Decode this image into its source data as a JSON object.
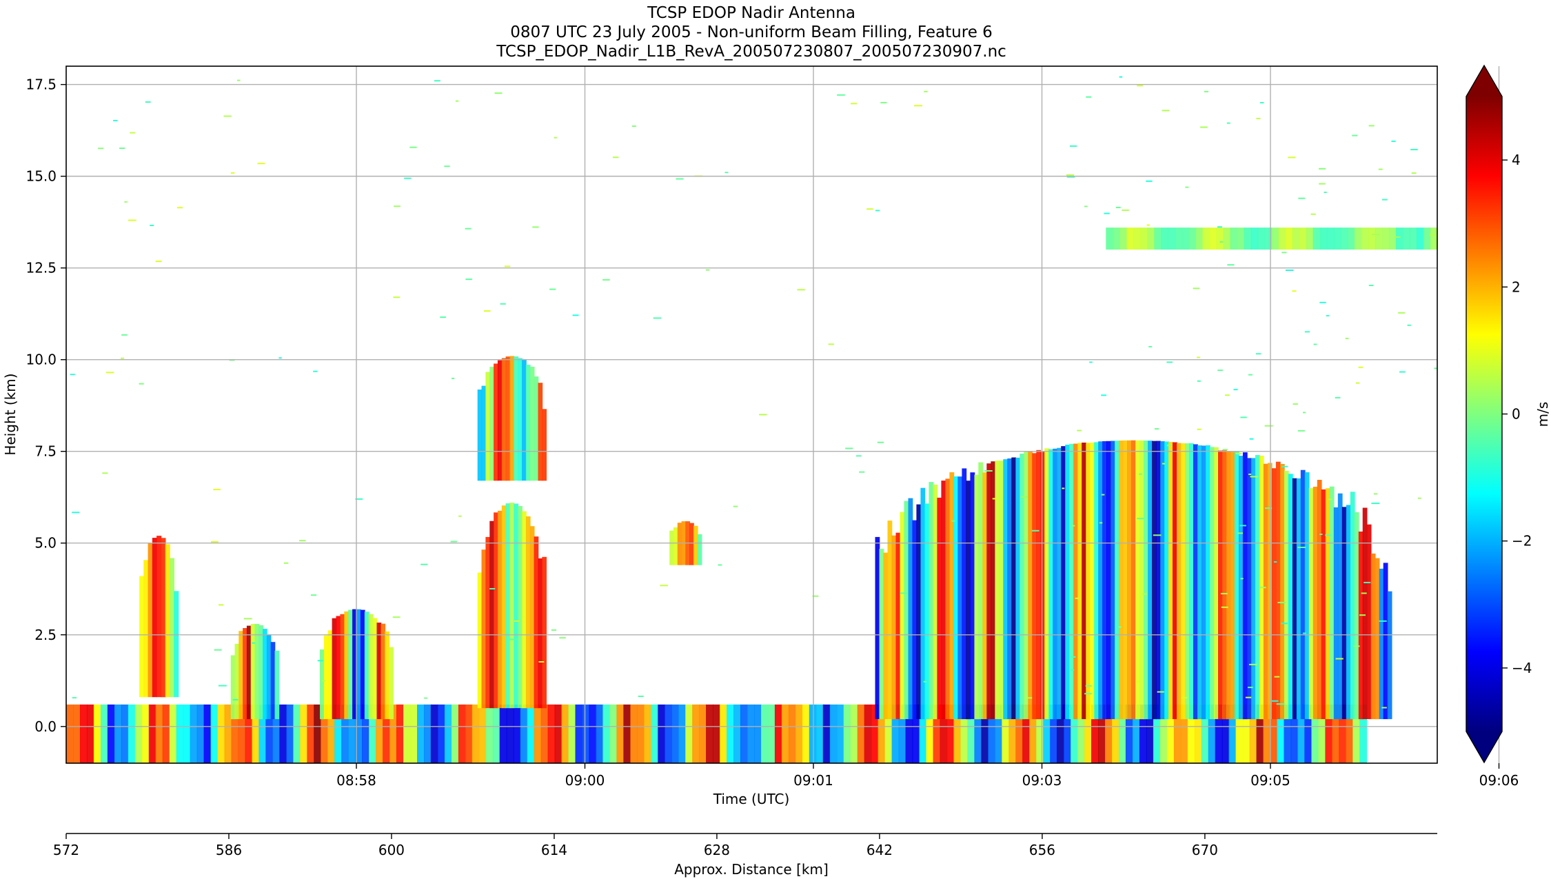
{
  "chart_data": {
    "type": "heatmap",
    "title_lines": [
      "TCSP EDOP Nadir Antenna",
      "0807 UTC 23 July 2005 - Non-uniform Beam Filling, Feature 6",
      "TCSP_EDOP_Nadir_L1B_RevA_200507230807_200507230907.nc"
    ],
    "xlabel": "Time (UTC)",
    "ylabel": "Height (km)",
    "x2label": "Approx. Distance [km]",
    "colorbar_label": "m/s",
    "grid": true,
    "colormap": "jet",
    "colormap_stops": [
      "#00007f",
      "#0000ff",
      "#007fff",
      "#00ffff",
      "#7fff7f",
      "#ffff00",
      "#ff7f00",
      "#ff0000",
      "#7f0000"
    ],
    "clim": [
      -5,
      5
    ],
    "ylim": [
      -1.0,
      18.0
    ],
    "yticks": [
      0.0,
      2.5,
      5.0,
      7.5,
      10.0,
      12.5,
      15.0,
      17.5
    ],
    "ytick_labels": [
      "0.0",
      "2.5",
      "5.0",
      "7.5",
      "10.0",
      "12.5",
      "15.0",
      "17.5"
    ],
    "xlim_minutes": [
      -1.27,
      4.73
    ],
    "xticks_minutes": [
      0,
      1,
      2,
      3,
      4,
      5,
      6
    ],
    "xtick_labels": [
      "08:58",
      "09:00",
      "09:01",
      "09:03",
      "09:05",
      "09:06"
    ],
    "x2lim": [
      572,
      690
    ],
    "x2ticks": [
      572,
      586,
      600,
      614,
      628,
      642,
      656,
      670
    ],
    "x2tick_labels": [
      "572",
      "586",
      "600",
      "614",
      "628",
      "642",
      "656",
      "670"
    ],
    "colorbar_ticks": [
      4,
      2,
      0,
      -2,
      -4
    ],
    "colorbar_tick_labels": [
      "4",
      "2",
      "0",
      "−2",
      "−4"
    ],
    "echo_features": [
      {
        "name": "surface",
        "x_range_minutes": [
          -1.27,
          4.42
        ],
        "height_range_km": [
          -1.0,
          0.6
        ],
        "velocity_range_ms": [
          -5,
          5
        ]
      },
      {
        "name": "cell-1",
        "x_range_minutes": [
          -0.95,
          -0.78
        ],
        "height_range_km": [
          0.8,
          5.2
        ],
        "velocity_range_ms": [
          -2,
          5
        ]
      },
      {
        "name": "cell-2",
        "x_range_minutes": [
          -0.55,
          -0.34
        ],
        "height_range_km": [
          0.2,
          2.8
        ],
        "velocity_range_ms": [
          -5,
          5
        ]
      },
      {
        "name": "cell-3",
        "x_range_minutes": [
          -0.16,
          0.16
        ],
        "height_range_km": [
          0.2,
          3.2
        ],
        "velocity_range_ms": [
          -5,
          5
        ]
      },
      {
        "name": "anvil-upper",
        "x_range_minutes": [
          0.53,
          0.83
        ],
        "height_range_km": [
          6.7,
          10.1
        ],
        "velocity_range_ms": [
          -3,
          5
        ]
      },
      {
        "name": "cell-4",
        "x_range_minutes": [
          0.53,
          0.83
        ],
        "height_range_km": [
          0.5,
          6.1
        ],
        "velocity_range_ms": [
          -2,
          5
        ]
      },
      {
        "name": "cell-5",
        "x_range_minutes": [
          1.37,
          1.51
        ],
        "height_range_km": [
          4.4,
          5.6
        ],
        "velocity_range_ms": [
          -2,
          4
        ]
      },
      {
        "name": "convective-complex",
        "x_range_minutes": [
          2.27,
          4.53
        ],
        "height_range_km": [
          0.2,
          7.8
        ],
        "velocity_range_ms": [
          -5,
          5
        ]
      },
      {
        "name": "cirrus-layer",
        "x_range_minutes": [
          3.28,
          4.73
        ],
        "height_range_km": [
          13.0,
          13.6
        ],
        "velocity_range_ms": [
          -1,
          1
        ]
      }
    ]
  }
}
